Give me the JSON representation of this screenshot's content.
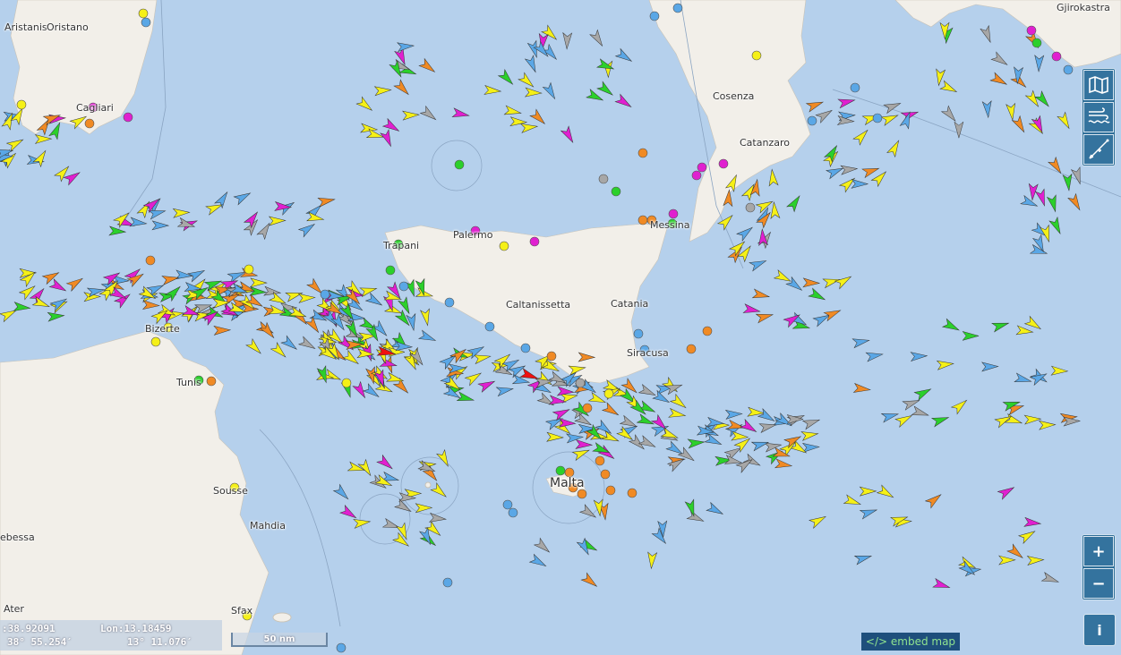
{
  "places": [
    {
      "id": "aristanis",
      "label": "Aristanis"
    },
    {
      "id": "oristano",
      "label": "Oristano"
    },
    {
      "id": "cagliari",
      "label": "Cagliari"
    },
    {
      "id": "cosenza",
      "label": "Cosenza"
    },
    {
      "id": "catanzaro",
      "label": "Catanzaro"
    },
    {
      "id": "gjirokastra",
      "label": "Gjirokastra"
    },
    {
      "id": "trapani",
      "label": "Trapani"
    },
    {
      "id": "palermo",
      "label": "Palermo"
    },
    {
      "id": "messina",
      "label": "Messina"
    },
    {
      "id": "caltanissetta",
      "label": "Caltanissetta"
    },
    {
      "id": "catania",
      "label": "Catania"
    },
    {
      "id": "siracusa",
      "label": "Siracusa"
    },
    {
      "id": "bizerte",
      "label": "Bizerte"
    },
    {
      "id": "tunis",
      "label": "Tunis"
    },
    {
      "id": "sousse",
      "label": "Sousse"
    },
    {
      "id": "mahdia",
      "label": "Mahdia"
    },
    {
      "id": "sfax",
      "label": "Sfax"
    },
    {
      "id": "tebessa",
      "label": "ebessa"
    },
    {
      "id": "ater",
      "label": "Ater"
    },
    {
      "id": "malta",
      "label": "Malta"
    }
  ],
  "coords": {
    "lat_decimal": ":38.92091",
    "lon_decimal": "Lon:13.18459",
    "lat_dms": "38° 55.254′",
    "lon_dms": "13° 11.076′"
  },
  "scale_label": "50 nm",
  "embed_label": "</> embed map",
  "controls": {
    "map_layers_icon": "map-icon",
    "weather_icon": "wind-waves-icon",
    "measure_icon": "ruler-icon",
    "zoom_in_label": "+",
    "zoom_out_label": "−",
    "info_label": "i"
  },
  "colors": {
    "sea": "#b5d0ec",
    "land": "#f2efe9",
    "cargo": "#f5f017",
    "tanker": "#f08a24",
    "passenger": "#5aa7e6",
    "fishing": "#e020d0",
    "special": "#2bd02b",
    "other": "#a7a7a7",
    "red_vessel": "#f01010"
  }
}
